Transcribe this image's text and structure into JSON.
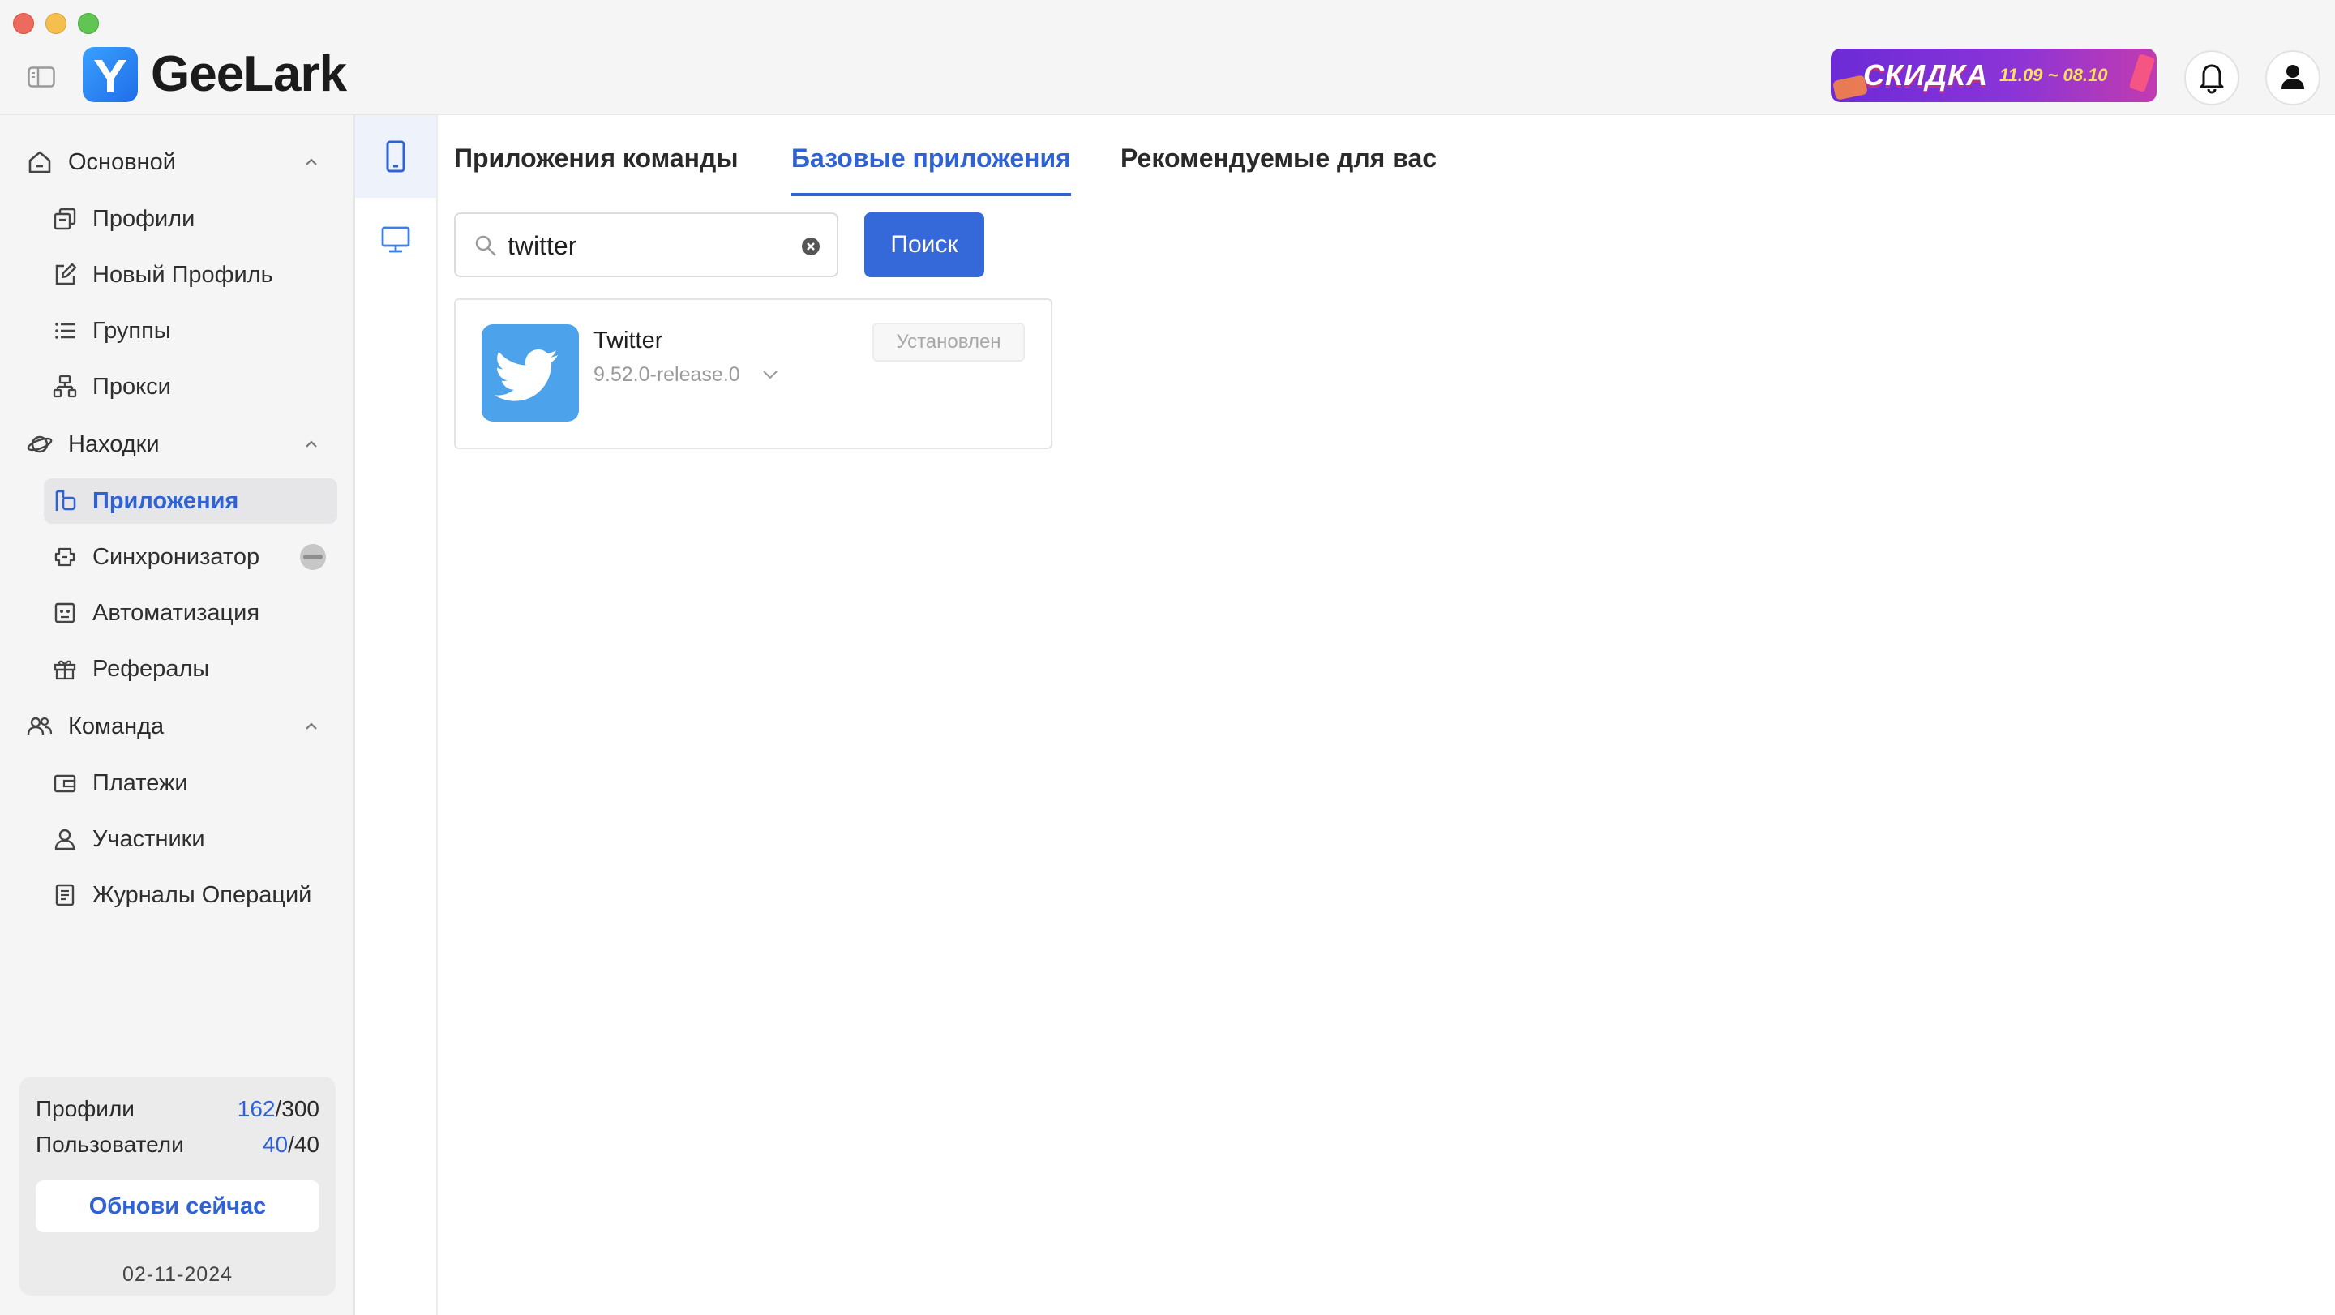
{
  "window": {
    "app_name": "GeeLark"
  },
  "promo": {
    "word": "СКИДКА",
    "dates": "11.09 ~ 08.10"
  },
  "sidebar": {
    "sections": [
      {
        "label": "Основной",
        "icon": "home-icon",
        "items": [
          {
            "label": "Профили",
            "icon": "profiles-icon"
          },
          {
            "label": "Новый Профиль",
            "icon": "edit-icon"
          },
          {
            "label": "Группы",
            "icon": "list-icon"
          },
          {
            "label": "Прокси",
            "icon": "network-icon"
          }
        ]
      },
      {
        "label": "Находки",
        "icon": "planet-icon",
        "items": [
          {
            "label": "Приложения",
            "icon": "apps-icon",
            "active": true
          },
          {
            "label": "Синхронизатор",
            "icon": "sync-icon"
          },
          {
            "label": "Автоматизация",
            "icon": "robot-icon"
          },
          {
            "label": "Рефералы",
            "icon": "gift-icon"
          }
        ]
      },
      {
        "label": "Команда",
        "icon": "team-icon",
        "items": [
          {
            "label": "Платежи",
            "icon": "wallet-icon"
          },
          {
            "label": "Участники",
            "icon": "member-icon"
          },
          {
            "label": "Журналы Операций",
            "icon": "log-icon"
          }
        ]
      }
    ]
  },
  "quota": {
    "profiles_label": "Профили",
    "profiles_used": "162",
    "profiles_total": "/300",
    "users_label": "Пользователи",
    "users_used": "40",
    "users_total": "/40",
    "upgrade_label": "Обнови сейчас",
    "date": "02-11-2024"
  },
  "tabs": [
    {
      "label": "Приложения команды"
    },
    {
      "label": "Базовые приложения",
      "active": true
    },
    {
      "label": "Рекомендуемые для вас"
    }
  ],
  "search": {
    "value": "twitter",
    "button_label": "Поиск"
  },
  "apps": [
    {
      "name": "Twitter",
      "version": "9.52.0-release.0",
      "status": "Установлен",
      "icon": "twitter-bird-icon"
    }
  ],
  "colors": {
    "accent": "#2f63d3",
    "button": "#3568d9",
    "twitter": "#4ca3ec"
  }
}
